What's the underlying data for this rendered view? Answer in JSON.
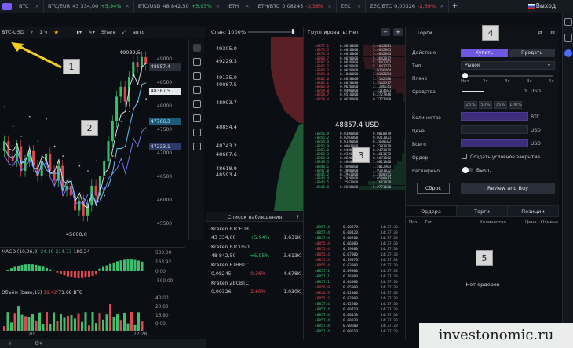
{
  "tabs": [
    {
      "pair": "BTC",
      "price": "",
      "change": "",
      "dir": ""
    },
    {
      "pair": "BTC/EUR",
      "price": "43 334,00",
      "change": "+5,94%",
      "dir": "up"
    },
    {
      "pair": "BTC/USD",
      "price": "48 842,50",
      "change": "+5,95%",
      "dir": "up"
    },
    {
      "pair": "ETH",
      "price": "",
      "change": "",
      "dir": ""
    },
    {
      "pair": "ETH/BTC",
      "price": "0,08245",
      "change": "-0,36%",
      "dir": "down"
    },
    {
      "pair": "ZEC",
      "price": "",
      "change": "",
      "dir": ""
    },
    {
      "pair": "ZEC/BTC",
      "price": "0,00326",
      "change": "-2,69%",
      "dir": "down"
    }
  ],
  "header": {
    "add_tab": "+",
    "exit_label": "Выход",
    "close": "×"
  },
  "chart_toolbar": {
    "symbol": "BTC-USD",
    "interval": "1 ч",
    "share": "Share",
    "auto": "авто"
  },
  "chart": {
    "high_label": "49039,5",
    "low_label": "45600,0",
    "yticks": [
      "49000",
      "48500",
      "48000",
      "47500",
      "47000",
      "46500",
      "46000",
      "45500"
    ],
    "price_tags": [
      {
        "value": "48857,4",
        "color": "#d6d9de",
        "bg": "#2a2f39"
      },
      {
        "value": "48387,5",
        "color": "#1b1f26",
        "bg": "#e6e8eb"
      },
      {
        "value": "47766,3",
        "color": "#bfe6ff",
        "bg": "#1c5a7a"
      },
      {
        "value": "47233,1",
        "color": "#d6d9de",
        "bg": "#2b3a66"
      }
    ],
    "x_labels": [
      "20",
      "22:28"
    ]
  },
  "macd": {
    "title": "MACD (10,26,9)",
    "v1": "34.49",
    "v2": "214.73",
    "v3": "180.24",
    "ticks": [
      "500.00",
      "163.92",
      "0.00",
      "-500.00"
    ]
  },
  "volume": {
    "title": "Объём (base,15)",
    "v1": "19.42",
    "v2": "71.68",
    "unit": "BTC",
    "ticks": [
      "40.00",
      "20.00",
      "16.90",
      "0.00"
    ]
  },
  "depth": {
    "title": "Спан: 1000%",
    "labels": [
      "49305.0",
      "49229.3",
      "49135.0",
      "49087.5",
      "48993.7",
      "48854.4",
      "48743.2",
      "48687.6",
      "48618.9",
      "48593.4"
    ]
  },
  "watchlist": {
    "title": "Список наблюдения",
    "items": [
      {
        "name": "Kraken BTCEUR",
        "price": "43 334,00",
        "change": "+5.94%",
        "vol": "1.631K",
        "dir": "up"
      },
      {
        "name": "Kraken BTCUSD",
        "price": "48 842,50",
        "change": "+5.95%",
        "vol": "3.613K",
        "dir": "up"
      },
      {
        "name": "Kraken ETHBTC",
        "price": "0,08245",
        "change": "-0.36%",
        "vol": "4.678K",
        "dir": "down"
      },
      {
        "name": "Kraken ZECBTC",
        "price": "0,00326",
        "change": "-2.69%",
        "vol": "1.030K",
        "dir": "down"
      }
    ]
  },
  "orderbook": {
    "group_label": "Группировать: Нет",
    "minus": "−",
    "plus": "+",
    "mid_price": "48857.4 USD",
    "asks": [
      [
        "48877.1",
        "0.0620000",
        "5.4642881"
      ],
      [
        "48875.5",
        "0.0620000",
        "5.4642861"
      ],
      [
        "48873.4",
        "0.0620000",
        "5.4642843"
      ],
      [
        "48869.7",
        "0.0620000",
        "5.3642817"
      ],
      [
        "48867.4",
        "0.0620000",
        "5.2642797"
      ],
      [
        "48865.2",
        "0.0620000",
        "5.1642773"
      ],
      [
        "48864.2",
        "0.0620000",
        "3.9166464"
      ],
      [
        "48863.4",
        "0.1000000",
        "3.8142654"
      ],
      [
        "48862.6",
        "0.0620000",
        "3.7142586"
      ],
      [
        "48862.1",
        "0.0620000",
        "3.5142517"
      ],
      [
        "48860.9",
        "0.0620000",
        "2.1286141"
      ],
      [
        "48859.8",
        "0.0400000",
        "1.3114601"
      ],
      [
        "48858.7",
        "0.0510000",
        "0.2727848"
      ],
      [
        "48858.4",
        "0.0620000",
        "0.2727489"
      ]
    ],
    "bids": [
      [
        "48856.9",
        "0.0300000",
        "0.0018879"
      ],
      [
        "48855.2",
        "0.0203000",
        "0.0213021"
      ],
      [
        "48854.9",
        "0.0138000",
        "0.2430102"
      ],
      [
        "48853.9",
        "0.0003000",
        "0.2393078"
      ],
      [
        "48853.0",
        "0.0400000",
        "0.2473079"
      ],
      [
        "48852.3",
        "0.0320000",
        "0.4613672"
      ],
      [
        "48850.4",
        "0.0620000",
        "0.5071862"
      ],
      [
        "48849.5",
        "0.4800000",
        "1.0811000"
      ],
      [
        "48848.1",
        "0.5000000",
        "1.5012903"
      ],
      [
        "48847.0",
        "0.3000000",
        "1.9181022"
      ],
      [
        "48845.2",
        "0.2963000",
        "2.2800451"
      ],
      [
        "48844.4",
        "0.7020000",
        "3.0580913"
      ],
      [
        "48843.5",
        "1.2563000",
        "4.7661020"
      ],
      [
        "48842.0",
        "0.0620000",
        "5.9771600"
      ]
    ]
  },
  "trades": {
    "rows": [
      [
        "48857.4",
        "0.00278",
        "14:37:30",
        "up"
      ],
      [
        "48857.4",
        "0.00120",
        "14:37:30",
        "up"
      ],
      [
        "48857.4",
        "0.00200",
        "14:37:30",
        "up"
      ],
      [
        "48855.4",
        "0.06000",
        "14:37:30",
        "down"
      ],
      [
        "48855.4",
        "0.19880",
        "14:37:30",
        "down"
      ],
      [
        "48855.4",
        "0.07000",
        "14:37:30",
        "down"
      ],
      [
        "48855.4",
        "0.19870",
        "14:37:30",
        "down"
      ],
      [
        "48855.4",
        "0.03000",
        "14:37:30",
        "down"
      ],
      [
        "48857.1",
        "0.09000",
        "14:37:30",
        "up"
      ],
      [
        "48857.1",
        "0.16000",
        "14:37:30",
        "up"
      ],
      [
        "48857.1",
        "0.04000",
        "14:37:30",
        "up"
      ],
      [
        "48856.9",
        "0.05000",
        "14:37:30",
        "down"
      ],
      [
        "48856.9",
        "0.02000",
        "14:37:30",
        "down"
      ],
      [
        "48855.7",
        "0.02300",
        "14:37:30",
        "down"
      ],
      [
        "48857.4",
        "0.02500",
        "14:37:30",
        "up"
      ],
      [
        "48857.4",
        "0.00710",
        "14:37:30",
        "up"
      ],
      [
        "48857.4",
        "0.00150",
        "14:37:30",
        "up"
      ],
      [
        "48857.4",
        "0.00030",
        "14:37:30",
        "up"
      ],
      [
        "48857.4",
        "0.00600",
        "14:37:29",
        "up"
      ],
      [
        "48857.4",
        "0.00610",
        "14:37:29",
        "up"
      ]
    ]
  },
  "form": {
    "title": "Торги",
    "action_label": "Действие",
    "buy": "Купить",
    "sell": "Продать",
    "type_label": "Тип",
    "type_value": "Рынок",
    "leverage_label": "Плечо",
    "leverage_ticks": [
      "Нет",
      "2x",
      "3x",
      "4x",
      "5x"
    ],
    "funds_label": "Средства",
    "funds_unit": "USD",
    "funds_value": "0",
    "percents": [
      "25%",
      "50%",
      "75%",
      "100%"
    ],
    "qty_label": "Количество",
    "qty_unit": "BTC",
    "price_label": "Цена",
    "price_unit": "USD",
    "total_label": "Всего",
    "total_unit": "USD",
    "order_label": "Ордер",
    "cond_close": "Создать условное закрытие",
    "advanced_label": "Расширено",
    "advanced_value": "Выкл.",
    "reset": "Сброс",
    "review": "Review and Buy"
  },
  "orders": {
    "tabs": [
      "Ордера",
      "Торги",
      "Позиции"
    ],
    "cols": [
      "Поз",
      "Тип",
      "Количество",
      "Цена",
      "Отмена"
    ],
    "empty": "Нет ордеров"
  },
  "annotations": [
    "1",
    "2",
    "3",
    "4",
    "5"
  ],
  "watermark": "investonomic.ru"
}
